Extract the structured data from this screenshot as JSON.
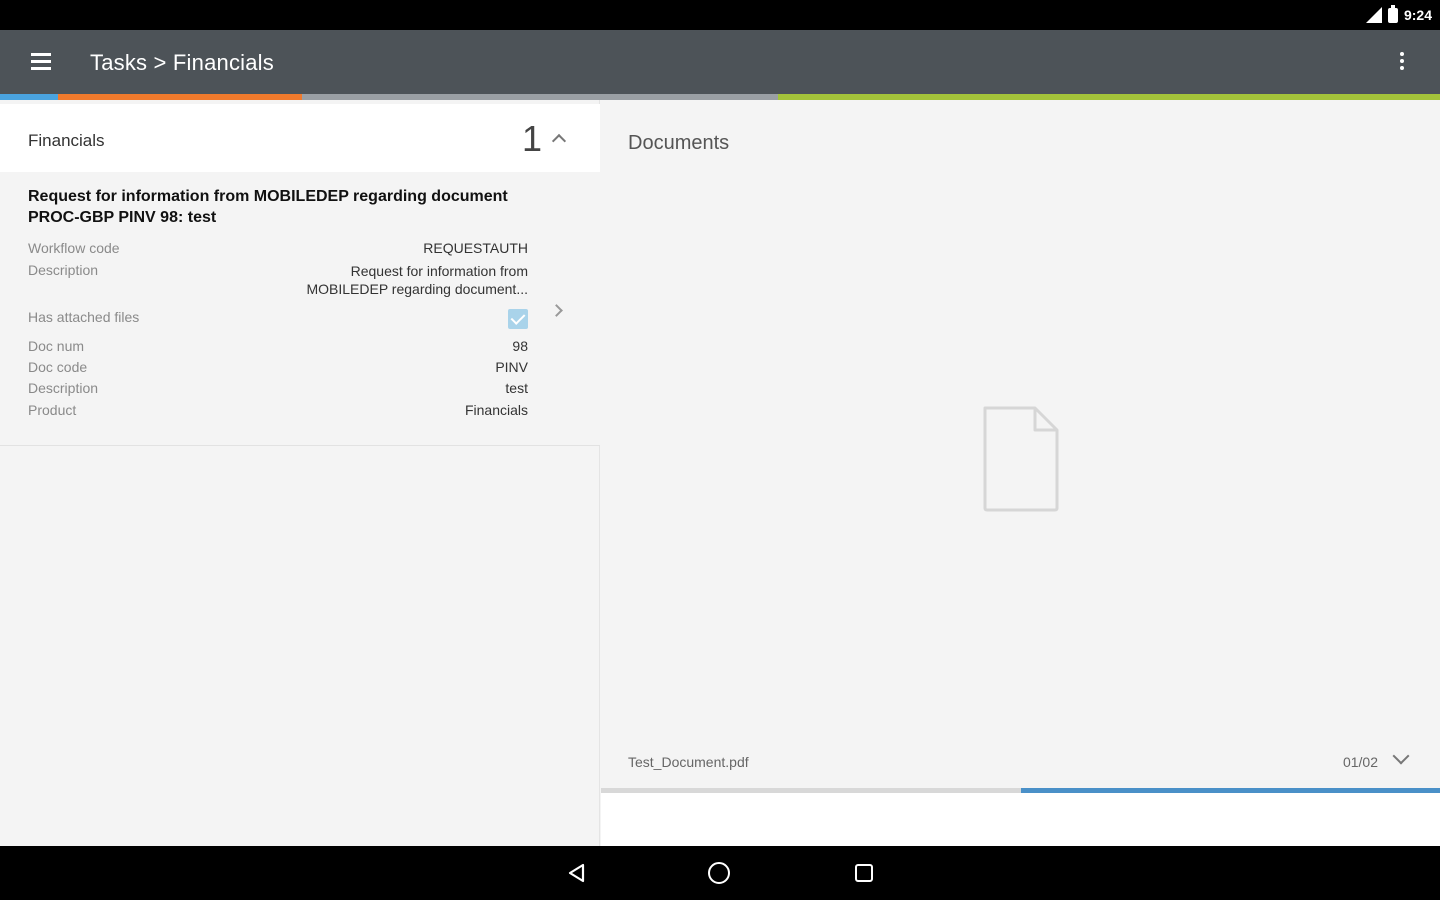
{
  "status_bar": {
    "time": "9:24"
  },
  "app_bar": {
    "title": "Tasks > Financials"
  },
  "colors": {
    "app_bar": "#4d5358",
    "strip_blue": "#4aa3df",
    "strip_orange": "#f07a2c",
    "strip_grey": "#9a9fa4",
    "strip_green": "#a4c33a",
    "checkbox": "#a9d3ea",
    "progress": "#4a90c8"
  },
  "left_panel": {
    "section_title": "Financials",
    "count": "1",
    "task": {
      "title": "Request for information from MOBILEDEP regarding document PROC-GBP PINV 98: test",
      "fields": {
        "workflow_code_label": "Workflow code",
        "workflow_code_value": "REQUESTAUTH",
        "description_label": "Description",
        "description_value": "Request for information from MOBILEDEP regarding document...",
        "has_files_label": "Has attached files",
        "has_files_checked": true,
        "doc_num_label": "Doc num",
        "doc_num_value": "98",
        "doc_code_label": "Doc code",
        "doc_code_value": "PINV",
        "description2_label": "Description",
        "description2_value": "test",
        "product_label": "Product",
        "product_value": "Financials"
      }
    }
  },
  "right_panel": {
    "title": "Documents",
    "file_name": "Test_Document.pdf",
    "page_indicator": "01/02",
    "progress_fraction": 0.5
  },
  "icons": {
    "menu": "hamburger-menu-icon",
    "overflow": "more-vert-icon",
    "document": "document-icon",
    "back": "back-triangle-icon",
    "home": "home-circle-icon",
    "recent": "recent-apps-square-icon"
  }
}
